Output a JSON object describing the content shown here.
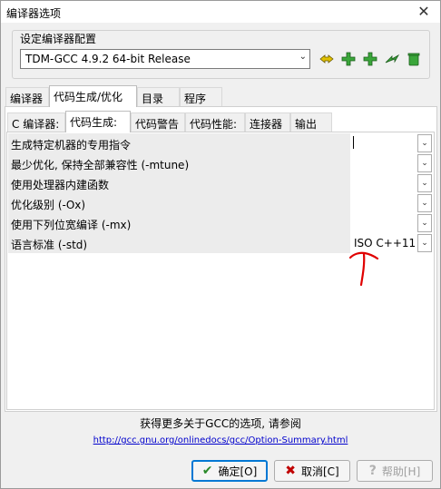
{
  "window": {
    "title": "编译器选项",
    "close": "✕"
  },
  "compiler_set": {
    "label": "设定编译器配置",
    "selected": "TDM-GCC 4.9.2 64-bit Release"
  },
  "toolbar_icons": [
    "rename-icon",
    "add-icon",
    "add-new-icon",
    "rename-arrow-icon",
    "delete-icon"
  ],
  "tabs_top": [
    "编译器",
    "代码生成/优化",
    "目录",
    "程序"
  ],
  "tabs_sub": [
    "C 编译器:",
    "代码生成:",
    "代码警告",
    "代码性能:",
    "连接器",
    "输出"
  ],
  "options": [
    {
      "label": "生成特定机器的专用指令",
      "value": ""
    },
    {
      "label": "最少优化, 保持全部兼容性 (-mtune)",
      "value": ""
    },
    {
      "label": "使用处理器内建函数",
      "value": ""
    },
    {
      "label": "优化级别 (-Ox)",
      "value": ""
    },
    {
      "label": "使用下列位宽编译 (-mx)",
      "value": ""
    },
    {
      "label": "语言标准 (-std)",
      "value": "ISO C++11"
    }
  ],
  "footer": {
    "text": "获得更多关于GCC的选项, 请参阅",
    "link": "http://gcc.gnu.org/onlinedocs/gcc/Option-Summary.html"
  },
  "buttons": {
    "ok": "确定[O]",
    "cancel": "取消[C]",
    "help": "帮助[H]"
  },
  "colors": {
    "annotation": "#e00000",
    "focus": "#0078d4"
  }
}
